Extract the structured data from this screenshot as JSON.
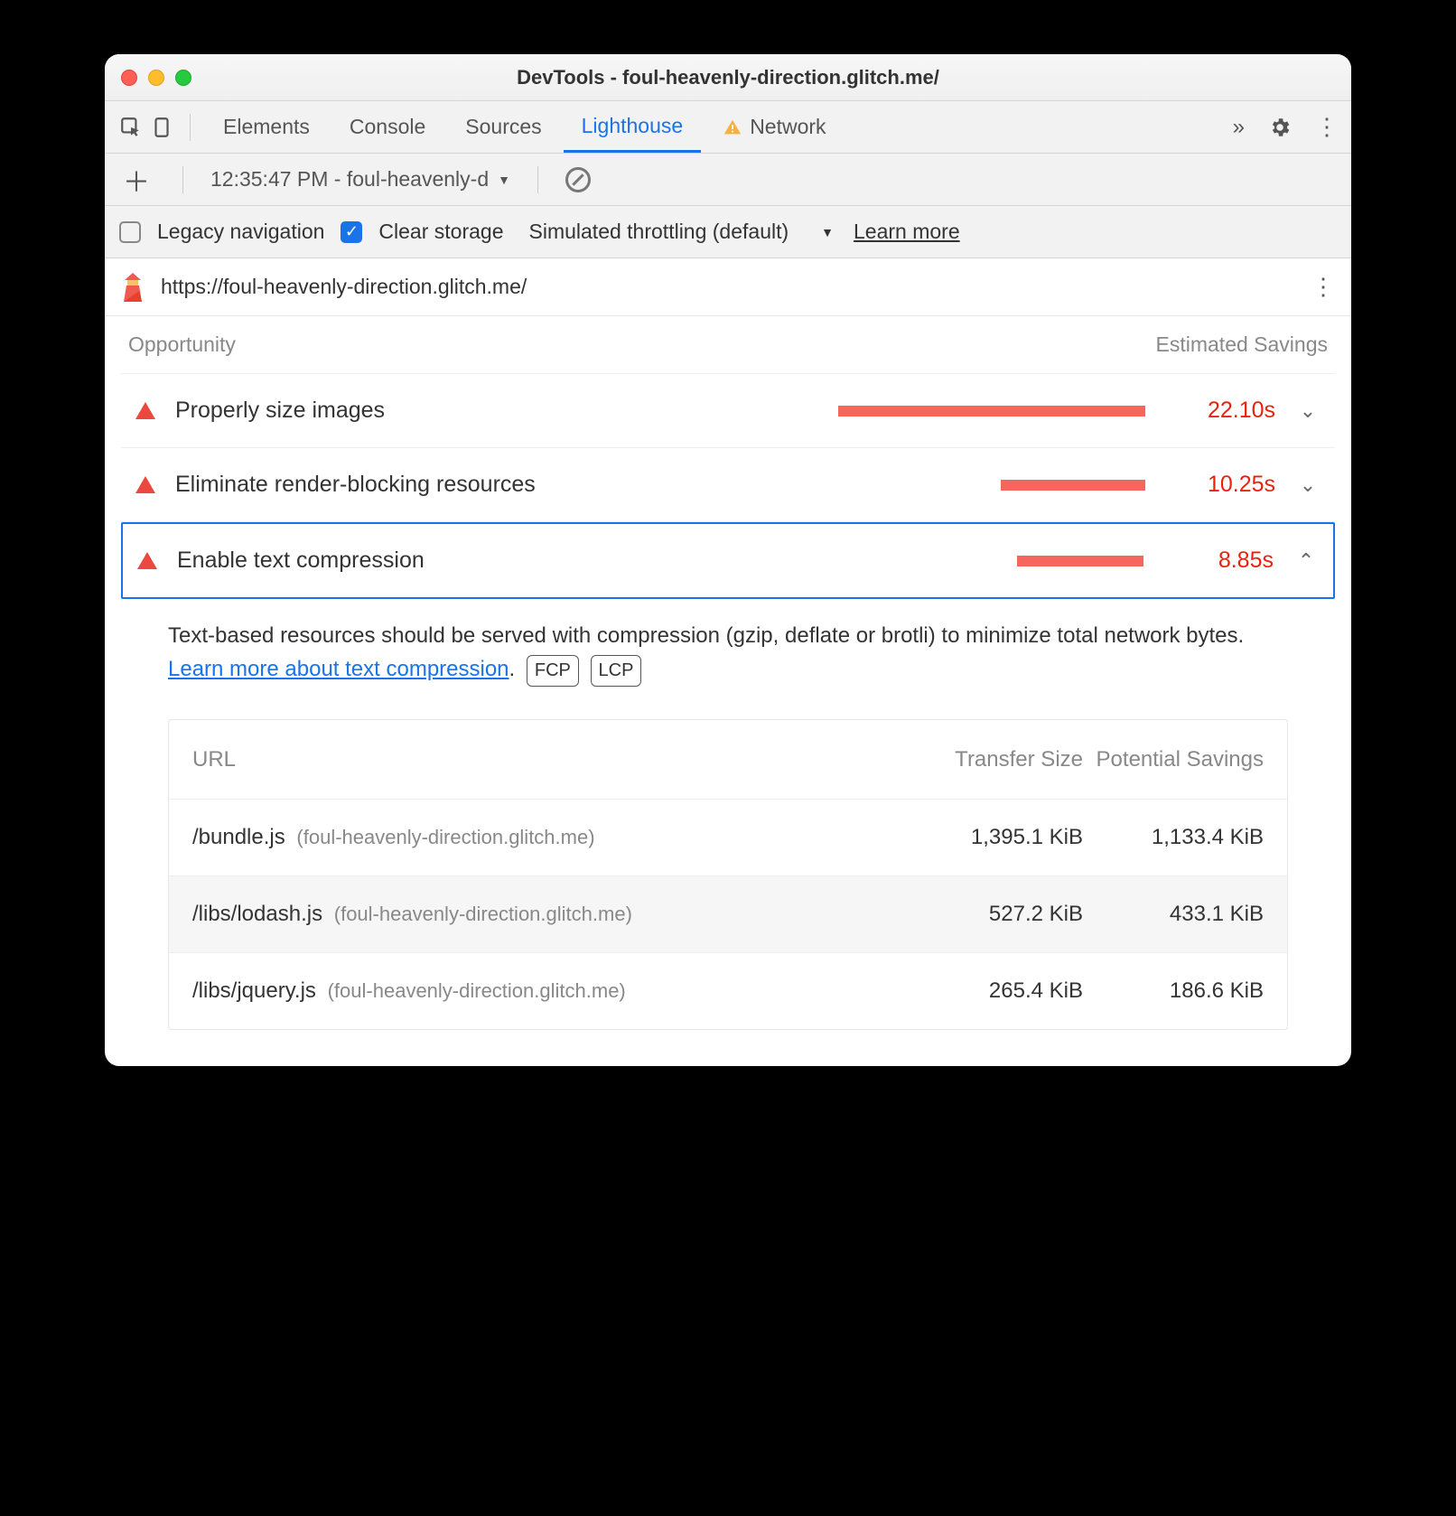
{
  "window": {
    "title": "DevTools - foul-heavenly-direction.glitch.me/"
  },
  "tabs": {
    "elements": "Elements",
    "console": "Console",
    "sources": "Sources",
    "lighthouse": "Lighthouse",
    "network": "Network"
  },
  "subbar": {
    "run_label": "12:35:47 PM - foul-heavenly-d"
  },
  "options": {
    "legacy": "Legacy navigation",
    "clear": "Clear storage",
    "throttle": "Simulated throttling (default)",
    "learn": "Learn more"
  },
  "urlbar": {
    "url": "https://foul-heavenly-direction.glitch.me/"
  },
  "headers": {
    "opportunity": "Opportunity",
    "estimated": "Estimated Savings"
  },
  "opps": [
    {
      "name": "Properly size images",
      "savings": "22.10s",
      "bar": 340,
      "expanded": false
    },
    {
      "name": "Eliminate render-blocking resources",
      "savings": "10.25s",
      "bar": 160,
      "expanded": false
    },
    {
      "name": "Enable text compression",
      "savings": "8.85s",
      "bar": 140,
      "expanded": true
    }
  ],
  "detail": {
    "text1": "Text-based resources should be served with compression (gzip, deflate or brotli) to minimize total network bytes. ",
    "link": "Learn more about text compression",
    "period": ".",
    "pills": [
      "FCP",
      "LCP"
    ]
  },
  "table": {
    "h_url": "URL",
    "h_size": "Transfer Size",
    "h_save": "Potential Savings",
    "rows": [
      {
        "path": "/bundle.js",
        "host": "(foul-heavenly-direction.glitch.me)",
        "size": "1,395.1 KiB",
        "save": "1,133.4 KiB"
      },
      {
        "path": "/libs/lodash.js",
        "host": "(foul-heavenly-direction.glitch.me)",
        "size": "527.2 KiB",
        "save": "433.1 KiB"
      },
      {
        "path": "/libs/jquery.js",
        "host": "(foul-heavenly-direction.glitch.me)",
        "size": "265.4 KiB",
        "save": "186.6 KiB"
      }
    ]
  }
}
